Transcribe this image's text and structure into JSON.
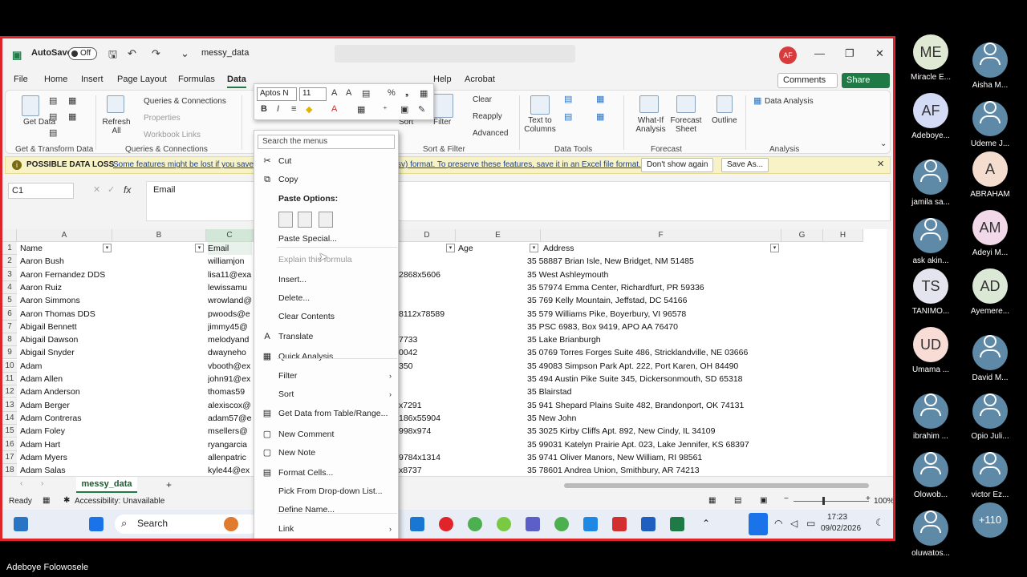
{
  "presenter_name": "Adeboye Folowosele",
  "excel": {
    "autosave_label": "AutoSave",
    "autosave_state": "Off",
    "file_name": "messy_data",
    "user_initials": "AF",
    "menu_tabs": [
      "File",
      "Home",
      "Insert",
      "Page Layout",
      "Formulas",
      "Data",
      "Review",
      "View",
      "Automate",
      "Developer",
      "Help",
      "Acrobat"
    ],
    "active_tab": "Data",
    "comments_label": "Comments",
    "share_label": "Share",
    "ribbon": {
      "get_data": "Get Data",
      "get_transform_group": "Get & Transform Data",
      "refresh_all": "Refresh All",
      "queries_connections": "Queries & Connections",
      "properties": "Properties",
      "workbook_links": "Workbook Links",
      "queries_group": "Queries & Connections",
      "sort": "Sort",
      "filter": "Filter",
      "clear": "Clear",
      "reapply": "Reapply",
      "advanced": "Advanced",
      "sort_filter_group": "Sort & Filter",
      "text_to_columns": "Text to Columns",
      "data_tools_group": "Data Tools",
      "what_if": "What-If Analysis",
      "forecast_sheet": "Forecast Sheet",
      "forecast_group": "Forecast",
      "outline": "Outline",
      "data_analysis": "Data Analysis",
      "analysis_group": "Analysis"
    },
    "infobar": {
      "lead": "POSSIBLE DATA LOSS",
      "message_a": "Some features might be lost if you save",
      "message_b": "sv) format. To preserve these features, save it in an Excel file format.",
      "dont_show": "Don't show again",
      "save_as": "Save As..."
    },
    "name_box": "C1",
    "formula_value": "Email",
    "columns": [
      {
        "letter": "A"
      },
      {
        "letter": "B"
      },
      {
        "letter": "C"
      },
      {
        "letter": "D"
      },
      {
        "letter": "E"
      },
      {
        "letter": "F"
      },
      {
        "letter": "G"
      },
      {
        "letter": "H"
      }
    ],
    "header_row": {
      "name": "Name",
      "email": "Email",
      "age": "Age",
      "address": "Address"
    },
    "rows": [
      {
        "n": "2",
        "name": "Aaron Bush",
        "email": "williamjon",
        "d": "",
        "age": "",
        "address": "35 58887 Brian Isle, New Bridget, NM 51485"
      },
      {
        "n": "3",
        "name": "Aaron Fernandez DDS",
        "email": "lisa11@exa",
        "d": "2868x5606",
        "age": "",
        "address": "35 West Ashleymouth"
      },
      {
        "n": "4",
        "name": "Aaron Ruiz",
        "email": "lewissamu",
        "d": "",
        "age": "",
        "address": "35 57974 Emma Center, Richardfurt, PR 59336"
      },
      {
        "n": "5",
        "name": "Aaron Simmons",
        "email": "wrowland@",
        "d": "",
        "age": "",
        "address": "35 769 Kelly Mountain, Jeffstad, DC 54166"
      },
      {
        "n": "6",
        "name": "Aaron Thomas DDS",
        "email": "pwoods@e",
        "d": "8112x78589",
        "age": "",
        "address": "35 579 Williams Pike, Boyerbury, VI 96578"
      },
      {
        "n": "7",
        "name": "Abigail Bennett",
        "email": "jimmy45@",
        "d": "",
        "age": "",
        "address": "35 PSC 6983, Box 9419, APO AA 76470"
      },
      {
        "n": "8",
        "name": "Abigail Dawson",
        "email": "melodyand",
        "d": "7733",
        "age": "",
        "address": "35 Lake Brianburgh"
      },
      {
        "n": "9",
        "name": "Abigail Snyder",
        "email": "dwayneho",
        "d": "0042",
        "age": "",
        "address": "35 0769 Torres Forges Suite 486, Stricklandville, NE 03666"
      },
      {
        "n": "10",
        "name": "Adam",
        "email": "vbooth@ex",
        "d": "350",
        "age": "",
        "address": "35 49083 Simpson Park Apt. 222, Port Karen, OH 84490"
      },
      {
        "n": "11",
        "name": "Adam Allen",
        "email": "john91@ex",
        "d": "",
        "age": "",
        "address": "35 494 Austin Pike Suite 345, Dickersonmouth, SD 65318"
      },
      {
        "n": "12",
        "name": "Adam Anderson",
        "email": "thomas59",
        "d": "",
        "age": "",
        "address": "35 Blairstad"
      },
      {
        "n": "13",
        "name": "Adam Berger",
        "email": "alexiscox@",
        "d": "x7291",
        "age": "",
        "address": "35 941 Shepard Plains Suite 482, Brandonport, OK 74131"
      },
      {
        "n": "14",
        "name": "Adam Contreras",
        "email": "adam57@e",
        "d": "186x55904",
        "age": "",
        "address": "35 New John"
      },
      {
        "n": "15",
        "name": "Adam Foley",
        "email": "msellers@",
        "d": "998x974",
        "age": "",
        "address": "35 3025 Kirby Cliffs Apt. 892, New Cindy, IL 34109"
      },
      {
        "n": "16",
        "name": "Adam Hart",
        "email": "ryangarcia",
        "d": "",
        "age": "",
        "address": "35 99031 Katelyn Prairie Apt. 023, Lake Jennifer, KS 68397"
      },
      {
        "n": "17",
        "name": "Adam Myers",
        "email": "allenpatric",
        "d": "9784x1314",
        "age": "",
        "address": "35 9741 Oliver Manors, New William, RI 98561"
      },
      {
        "n": "18",
        "name": "Adam Salas",
        "email": "kyle44@ex",
        "d": "x8737",
        "age": "",
        "address": "35 78601 Andrea Union, Smithbury, AR 74213"
      }
    ],
    "sheet_tab": "messy_data",
    "status_ready": "Ready",
    "accessibility": "Accessibility: Unavailable",
    "zoom": "100%",
    "taskbar_search": "Search",
    "clock_time": "17:23",
    "clock_date": "09/02/2026"
  },
  "mini_toolbar": {
    "font": "Aptos N",
    "size": "11"
  },
  "context_menu": {
    "search_placeholder": "Search the menus",
    "items": [
      {
        "label": "Cut",
        "icon": "scissors-icon",
        "glyph": "✂"
      },
      {
        "label": "Copy",
        "icon": "copy-icon",
        "glyph": "⧉"
      },
      {
        "label": "Paste Options:",
        "icon": "",
        "glyph": ""
      },
      {
        "label": "Paste Special...",
        "icon": "",
        "glyph": ""
      },
      {
        "label": "Explain this formula",
        "icon": "",
        "glyph": ""
      },
      {
        "label": "Insert...",
        "icon": "",
        "glyph": ""
      },
      {
        "label": "Delete...",
        "icon": "",
        "glyph": ""
      },
      {
        "label": "Clear Contents",
        "icon": "",
        "glyph": ""
      },
      {
        "label": "Translate",
        "icon": "translate-icon",
        "glyph": "A"
      },
      {
        "label": "Quick Analysis",
        "icon": "quick-analysis-icon",
        "glyph": "▦"
      },
      {
        "label": "Filter",
        "icon": "",
        "glyph": ""
      },
      {
        "label": "Sort",
        "icon": "",
        "glyph": ""
      },
      {
        "label": "Get Data from Table/Range...",
        "icon": "table-icon",
        "glyph": "▤"
      },
      {
        "label": "New Comment",
        "icon": "comment-icon",
        "glyph": "▢"
      },
      {
        "label": "New Note",
        "icon": "note-icon",
        "glyph": "▢"
      },
      {
        "label": "Format Cells...",
        "icon": "format-cells-icon",
        "glyph": "▤"
      },
      {
        "label": "Pick From Drop-down List...",
        "icon": "",
        "glyph": ""
      },
      {
        "label": "Define Name...",
        "icon": "",
        "glyph": ""
      },
      {
        "label": "Link",
        "icon": "",
        "glyph": ""
      }
    ]
  },
  "participants": [
    {
      "initials": "ME",
      "name": "Miracle E...",
      "bg": "#dfe9d3"
    },
    {
      "initials": "",
      "name": "Aisha M...",
      "bg": ""
    },
    {
      "initials": "AF",
      "name": "Adeboye...",
      "bg": "#d4dcf5"
    },
    {
      "initials": "",
      "name": "Udeme J...",
      "bg": ""
    },
    {
      "initials": "",
      "name": "jamila sa...",
      "bg": ""
    },
    {
      "initials": "A",
      "name": "ABRAHAM",
      "bg": "#f4dccf"
    },
    {
      "initials": "",
      "name": "ask akin...",
      "bg": ""
    },
    {
      "initials": "AM",
      "name": "Adeyi M...",
      "bg": "#f2d9e9"
    },
    {
      "initials": "TS",
      "name": "TANIMO...",
      "bg": "#e4e4ee"
    },
    {
      "initials": "AD",
      "name": "Ayemere...",
      "bg": "#dce8d6"
    },
    {
      "initials": "UD",
      "name": "Umama ...",
      "bg": "#f8dcd6"
    },
    {
      "initials": "",
      "name": "David M...",
      "bg": ""
    },
    {
      "initials": "",
      "name": "ibrahim ...",
      "bg": ""
    },
    {
      "initials": "",
      "name": "Opio Juli...",
      "bg": ""
    },
    {
      "initials": "",
      "name": "Olowob...",
      "bg": ""
    },
    {
      "initials": "",
      "name": "victor Ez...",
      "bg": ""
    },
    {
      "initials": "",
      "name": "oluwatos...",
      "bg": ""
    },
    {
      "initials": "+110",
      "name": "",
      "bg": "#5e8aa7"
    }
  ],
  "colors": {
    "excel_green": "#1e7b45",
    "frame_red": "#e0242a",
    "participant_avatar": "#5e8aa7"
  }
}
